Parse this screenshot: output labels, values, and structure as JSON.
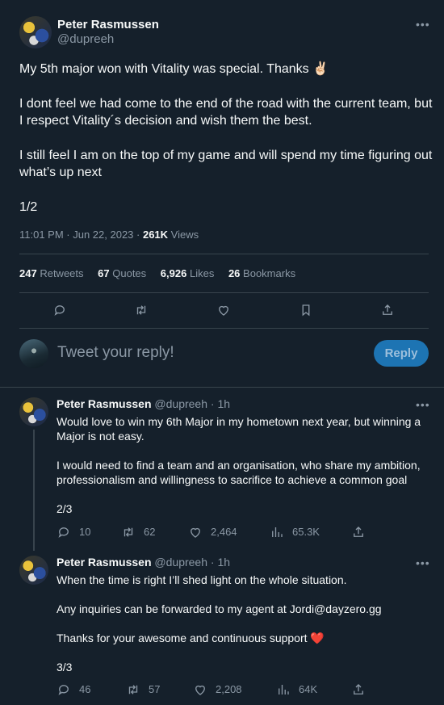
{
  "main_tweet": {
    "name": "Peter Rasmussen",
    "handle": "@dupreeh",
    "lines": [
      "My 5th major won with Vitality was special. Thanks ✌🏻",
      "I dont feel we had come to the end of the road with the current team, but",
      "I respect Vitality´s decision and wish them the best.",
      "I still feel I am on the top of my game and will spend my time figuring out",
      "what’s up next",
      "1/2"
    ],
    "time": "11:01 PM · Jun 22, 2023 · ",
    "views_count": "261K",
    "views_label": " Views",
    "stats": {
      "retweets_count": "247",
      "retweets_label": "Retweets",
      "quotes_count": "67",
      "quotes_label": "Quotes",
      "likes_count": "6,926",
      "likes_label": "Likes",
      "bookmarks_count": "26",
      "bookmarks_label": "Bookmarks"
    }
  },
  "reply_box": {
    "placeholder": "Tweet your reply!",
    "button_label": "Reply"
  },
  "replies": [
    {
      "name": "Peter Rasmussen",
      "meta": "@dupreeh · 1h",
      "lines": [
        "Would love to win my 6th Major in my hometown next year, but winning a",
        "Major is not easy.",
        "I would need to find a team and an organisation, who share my ambition,",
        "professionalism and willingness to sacrifice to achieve a common goal",
        "2/3"
      ],
      "replies": "10",
      "retweets": "62",
      "likes": "2,464",
      "views": "65.3K"
    },
    {
      "name": "Peter Rasmussen",
      "meta": "@dupreeh · 1h",
      "lines": [
        "When the time is right I’ll shed light on the whole situation.",
        "Any inquiries can be forwarded to my agent at Jordi@dayzero.gg",
        "Thanks for your awesome and continuous support ❤️",
        "3/3"
      ],
      "replies": "46",
      "retweets": "57",
      "likes": "2,208",
      "views": "64K"
    }
  ],
  "icons": [
    "reply-icon",
    "retweet-icon",
    "like-icon",
    "bookmark-icon",
    "share-icon",
    "views-icon",
    "more-icon"
  ],
  "colors": {
    "background": "#15202b",
    "muted": "#8b98a5",
    "divider": "#38444d",
    "reply_button": "#1d74b3",
    "heart": "#f4212e"
  }
}
